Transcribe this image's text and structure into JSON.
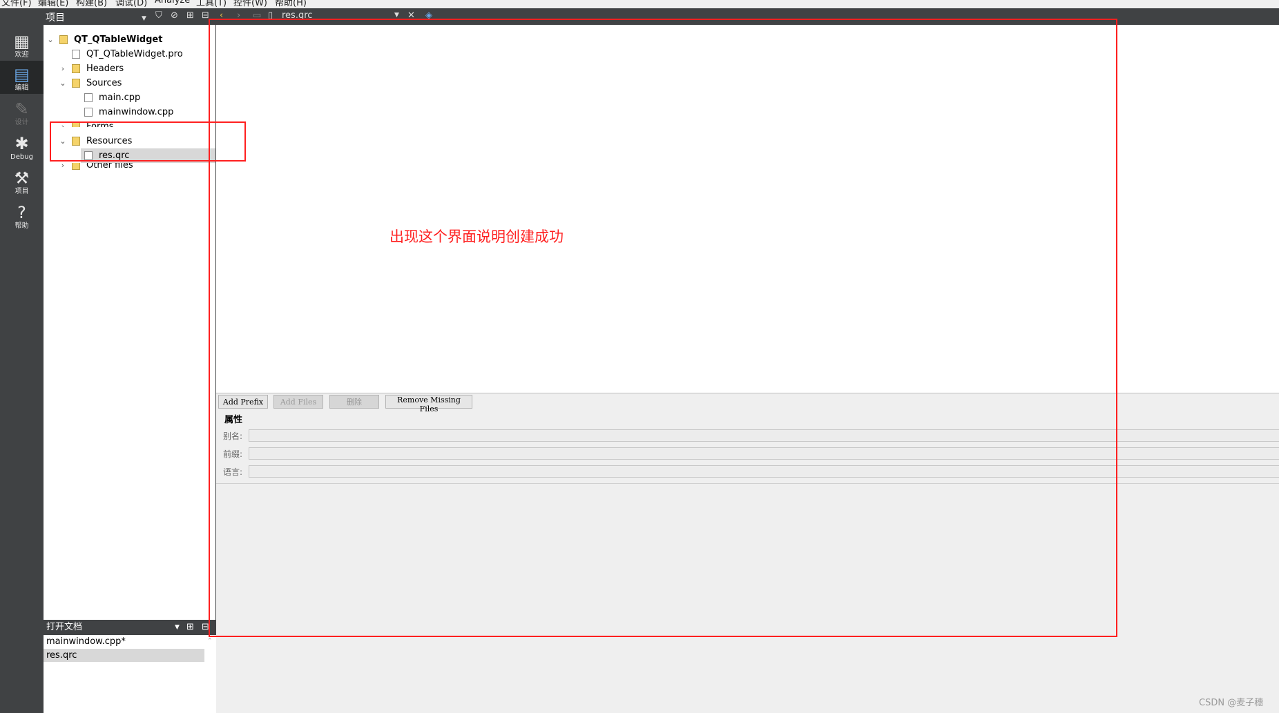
{
  "menu": [
    "文件(F)",
    "编辑(E)",
    "构建(B)",
    "调试(D)",
    "Analyze",
    "工具(T)",
    "控件(W)",
    "帮助(H)"
  ],
  "projects_pane": {
    "title": "项目"
  },
  "document_combo": {
    "value": "res.qrc"
  },
  "modes": [
    {
      "label": "欢迎",
      "icon": "welcome-grid-icon"
    },
    {
      "label": "编辑",
      "icon": "edit-document-icon"
    },
    {
      "label": "设计",
      "icon": "design-pencil-icon"
    },
    {
      "label": "Debug",
      "icon": "debug-bug-icon"
    },
    {
      "label": "项目",
      "icon": "projects-wrench-icon"
    },
    {
      "label": "帮助",
      "icon": "help-question-icon"
    }
  ],
  "tree": [
    "QT_QTableWidget",
    "QT_QTableWidget.pro",
    "Headers",
    "Sources",
    "main.cpp",
    "mainwindow.cpp",
    "Forms",
    "Resources",
    "res.qrc",
    "Other files"
  ],
  "open_docs": {
    "title": "打开文档",
    "items": [
      "mainwindow.cpp*",
      "res.qrc"
    ]
  },
  "annotation": "出现这个界面说明创建成功",
  "resource_editor": {
    "buttons": [
      "Add Prefix",
      "Add Files",
      "删除",
      "Remove Missing Files"
    ],
    "properties_title": "属性",
    "fields": [
      "别名:",
      "前缀:",
      "语言:"
    ]
  },
  "watermark": "CSDN @麦子穗",
  "colors": {
    "dark_panel": "#404244",
    "annotation_red": "#ff1f1f"
  }
}
